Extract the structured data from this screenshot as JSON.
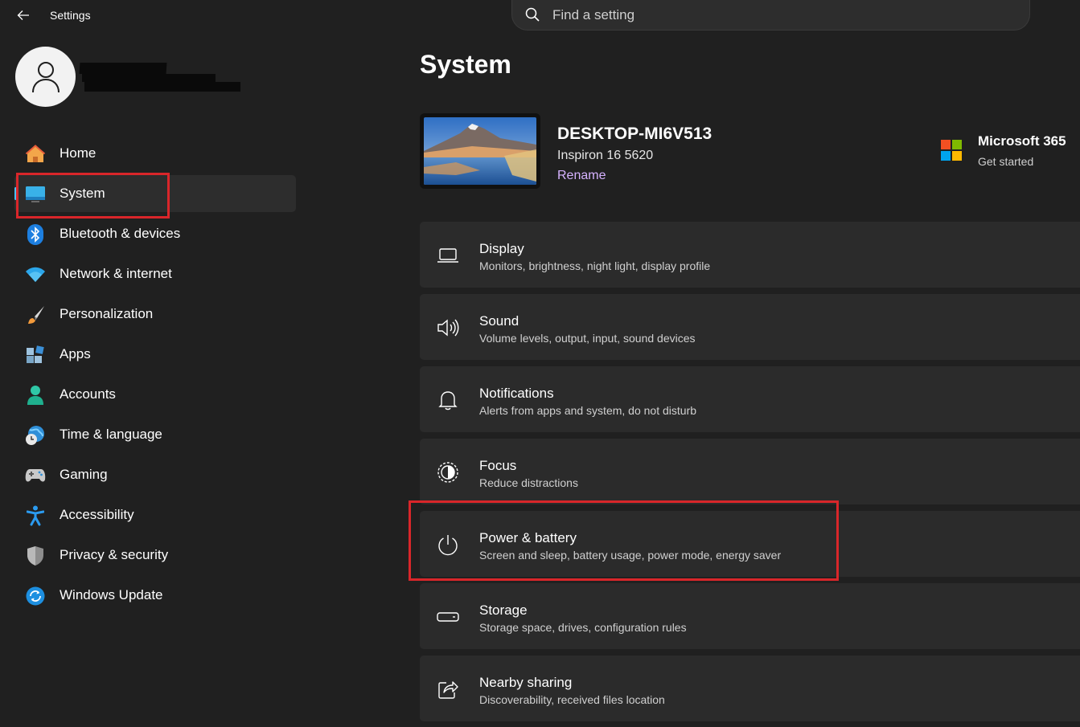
{
  "app": {
    "title": "Settings"
  },
  "search": {
    "placeholder": "Find a setting"
  },
  "sidebar": {
    "items": [
      {
        "label": "Home",
        "icon": "home-icon"
      },
      {
        "label": "System",
        "icon": "monitor-icon",
        "selected": true
      },
      {
        "label": "Bluetooth & devices",
        "icon": "bluetooth-icon"
      },
      {
        "label": "Network & internet",
        "icon": "wifi-icon"
      },
      {
        "label": "Personalization",
        "icon": "brush-icon"
      },
      {
        "label": "Apps",
        "icon": "apps-icon"
      },
      {
        "label": "Accounts",
        "icon": "person-icon"
      },
      {
        "label": "Time & language",
        "icon": "globe-clock-icon"
      },
      {
        "label": "Gaming",
        "icon": "gamepad-icon"
      },
      {
        "label": "Accessibility",
        "icon": "accessibility-icon"
      },
      {
        "label": "Privacy & security",
        "icon": "shield-icon"
      },
      {
        "label": "Windows Update",
        "icon": "update-icon"
      }
    ]
  },
  "main": {
    "title": "System",
    "device": {
      "name": "DESKTOP-MI6V513",
      "model": "Inspiron 16 5620",
      "rename_label": "Rename"
    },
    "promo": {
      "title": "Microsoft 365",
      "subtitle": "Get started"
    },
    "cards": [
      {
        "title": "Display",
        "subtitle": "Monitors, brightness, night light, display profile",
        "icon": "laptop-icon"
      },
      {
        "title": "Sound",
        "subtitle": "Volume levels, output, input, sound devices",
        "icon": "speaker-icon"
      },
      {
        "title": "Notifications",
        "subtitle": "Alerts from apps and system, do not disturb",
        "icon": "bell-icon"
      },
      {
        "title": "Focus",
        "subtitle": "Reduce distractions",
        "icon": "focus-icon"
      },
      {
        "title": "Power & battery",
        "subtitle": "Screen and sleep, battery usage, power mode, energy saver",
        "icon": "power-icon"
      },
      {
        "title": "Storage",
        "subtitle": "Storage space, drives, configuration rules",
        "icon": "storage-icon"
      },
      {
        "title": "Nearby sharing",
        "subtitle": "Discoverability, received files location",
        "icon": "share-icon"
      }
    ]
  },
  "colors": {
    "background": "#202020",
    "card": "#2b2b2b",
    "accent": "#4cc2ff",
    "link": "#d6b2ff",
    "highlight": "#d9262a"
  }
}
